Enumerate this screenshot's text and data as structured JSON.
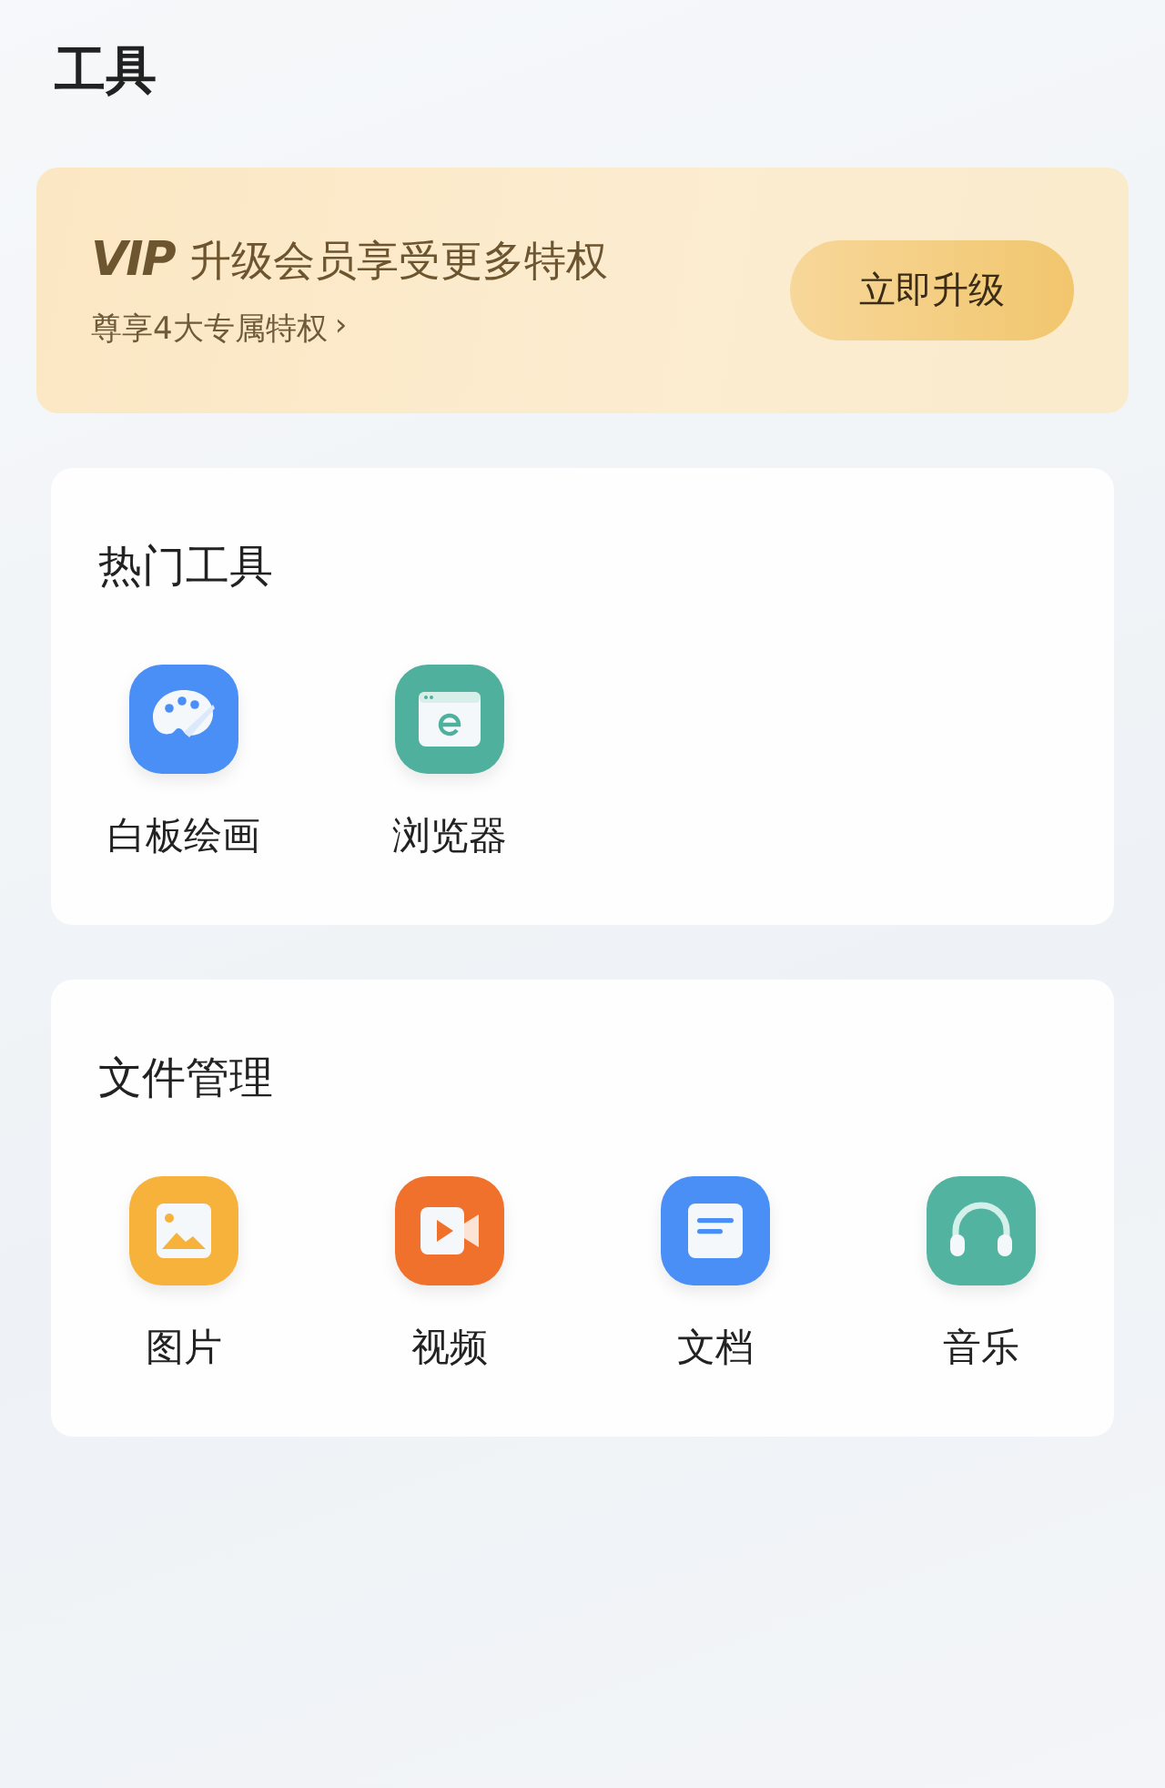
{
  "page": {
    "title": "工具"
  },
  "vip_banner": {
    "logo": "VIP",
    "headline": "升级会员享受更多特权",
    "subline": "尊享4大专属特权",
    "chevron": "›",
    "button": "立即升级"
  },
  "sections": [
    {
      "title": "热门工具",
      "tools": [
        {
          "label": "白板绘画",
          "kind": "palette",
          "color": "#4a8ff5"
        },
        {
          "label": "浏览器",
          "kind": "browser",
          "color": "#4fb09e"
        }
      ]
    },
    {
      "title": "文件管理",
      "tools": [
        {
          "label": "图片",
          "kind": "image",
          "color": "#f6b23a"
        },
        {
          "label": "视频",
          "kind": "video",
          "color": "#f0712c"
        },
        {
          "label": "文档",
          "kind": "document",
          "color": "#4a8ff5"
        },
        {
          "label": "音乐",
          "kind": "headphones",
          "color": "#52b4a0"
        }
      ]
    }
  ]
}
